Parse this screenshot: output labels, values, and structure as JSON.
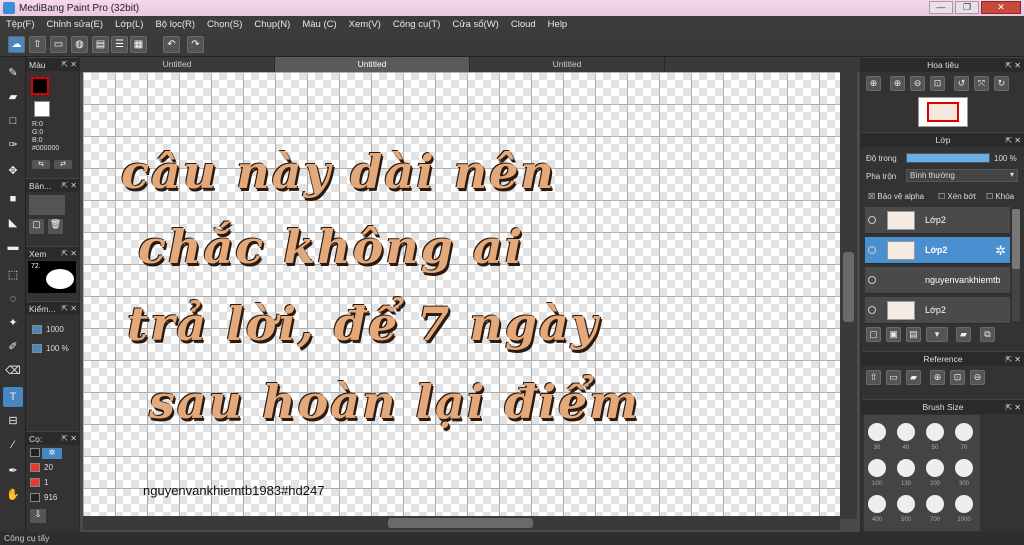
{
  "window": {
    "title": "MediBang Paint Pro (32bit)",
    "minimize": "—",
    "maximize": "❐",
    "close": "✕"
  },
  "menu": [
    "Tệp(F)",
    "Chỉnh sửa(E)",
    "Lớp(L)",
    "Bộ lọc(R)",
    "Chọn(S)",
    "Chụp(N)",
    "Màu (C)",
    "Xem(V)",
    "Công cụ(T)",
    "Cửa sổ(W)",
    "Cloud",
    "Help"
  ],
  "tabs": [
    "Untitled",
    "Untitled",
    "Untitled"
  ],
  "left_panels": {
    "color": {
      "title": "Màu",
      "r": "R:0",
      "g": "G:0",
      "b": "B:0",
      "hex": "#000000"
    },
    "brush": {
      "title": "Bản..."
    },
    "navigator": {
      "title": "Xem",
      "zoom": "72."
    },
    "check": {
      "title": "Kiểm...",
      "value1": "1000",
      "value2": "100 %"
    },
    "colorset": {
      "title": "Cọ:",
      "rows": [
        {
          "value": "20",
          "color": "#e53935"
        },
        {
          "value": "1",
          "color": "#e53935"
        },
        {
          "value": "916",
          "color": "#222222"
        }
      ]
    }
  },
  "canvas": {
    "lines": [
      "câu này dài nên",
      "chắc  không  ai",
      "trả lời, để 7 ngày",
      "sau hoàn lại điểm"
    ],
    "signature": "nguyenvankhiemtb1983#hd247"
  },
  "right": {
    "navigator_title": "Hoa tiêu",
    "layer_title": "Lớp",
    "opacity_label": "Độ trong",
    "opacity_value": "100 %",
    "opacity": 1.0,
    "blend_label": "Pha trộn",
    "blend_value": "Bình thường",
    "protect_alpha": "Bảo vệ alpha",
    "clipping": "Xén bớt",
    "lock": "Khóa",
    "layers": [
      {
        "name": "Lớp2",
        "selected": false
      },
      {
        "name": "Lớp2",
        "selected": true
      },
      {
        "name": "nguyenvankhiemtb",
        "selected": false
      },
      {
        "name": "Lớp2",
        "selected": false
      }
    ],
    "reference_title": "Reference",
    "brushsize_title": "Brush Size",
    "brush_sizes": [
      "30",
      "40",
      "50",
      "70",
      "100",
      "130",
      "200",
      "300",
      "400",
      "500",
      "700",
      "1000"
    ]
  },
  "status": "Công cụ tẩy",
  "colors": {
    "accent": "#4a86c0",
    "text_fill": "#e4a97a",
    "text_shadow": "#2a1a10"
  }
}
